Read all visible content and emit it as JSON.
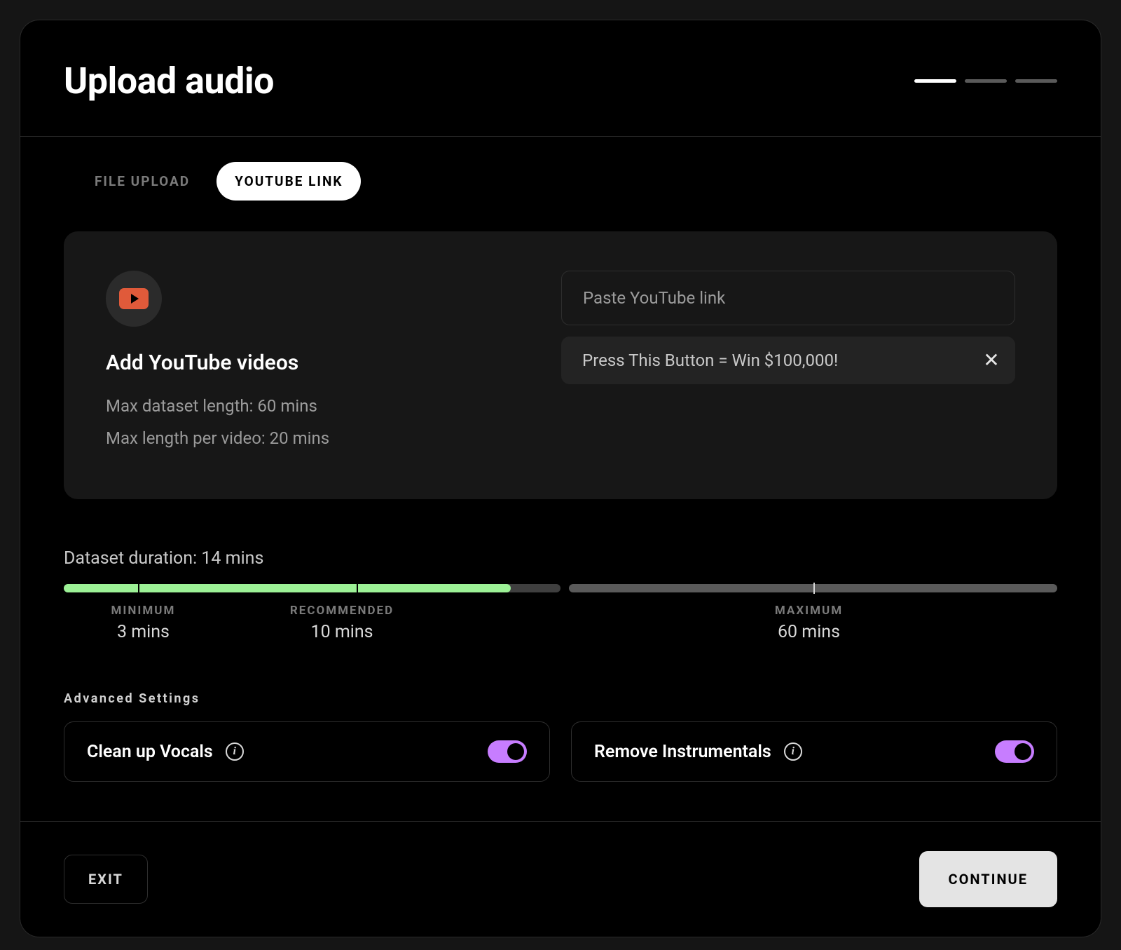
{
  "header": {
    "title": "Upload audio",
    "steps_total": 3,
    "step_active_index": 0
  },
  "tabs": [
    {
      "label": "File upload",
      "active": false
    },
    {
      "label": "YouTube link",
      "active": true
    }
  ],
  "panel": {
    "heading": "Add YouTube videos",
    "line1": "Max dataset length: 60 mins",
    "line2": "Max length per video: 20 mins",
    "input_placeholder": "Paste YouTube link",
    "chip_title": "Press This Button = Win $100,000!"
  },
  "duration": {
    "label": "Dataset duration: 14 mins",
    "fill_percent_of_left_track": 90,
    "min_label": "Minimum",
    "min_value": "3 mins",
    "rec_label": "Recommended",
    "rec_value": "10 mins",
    "max_label": "Maximum",
    "max_value": "60 mins"
  },
  "advanced": {
    "section_title": "Advanced Settings",
    "options": [
      {
        "label": "Clean up Vocals",
        "on": true
      },
      {
        "label": "Remove Instrumentals",
        "on": true
      }
    ]
  },
  "footer": {
    "exit": "Exit",
    "continue": "Continue"
  }
}
